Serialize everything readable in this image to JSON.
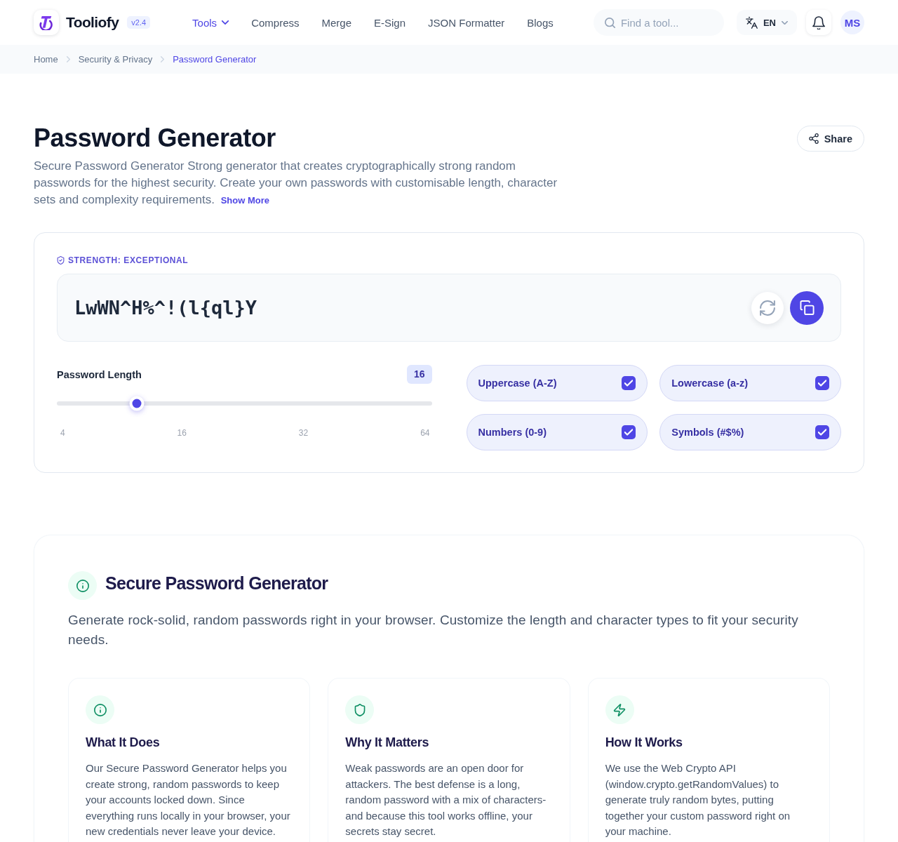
{
  "header": {
    "brand": "Tooliofy",
    "version": "v2.4",
    "nav": [
      {
        "label": "Tools",
        "kind": "menu",
        "selected": true
      },
      {
        "label": "Compress",
        "kind": "link",
        "selected": false
      },
      {
        "label": "Merge",
        "kind": "link",
        "selected": false
      },
      {
        "label": "E-Sign",
        "kind": "link",
        "selected": false
      },
      {
        "label": "JSON Formatter",
        "kind": "link",
        "selected": false
      },
      {
        "label": "Blogs",
        "kind": "link",
        "selected": false
      }
    ],
    "search": {
      "placeholder": "Find a tool..."
    },
    "language": "EN",
    "avatar": "MS"
  },
  "breadcrumb": [
    {
      "label": "Home",
      "current": false
    },
    {
      "label": "Security & Privacy",
      "current": false
    },
    {
      "label": "Password Generator",
      "current": true
    }
  ],
  "intro": {
    "title": "Password Generator",
    "description": "Secure Password Generator Strong generator that creates cryptographically strong random passwords for the highest security. Create your own passwords with customisable length, character sets and complexity requirements.",
    "show_more": "Show More",
    "share": "Share"
  },
  "generator": {
    "strength": "STRENGTH: EXCEPTIONAL",
    "password": "LwWN^H%^!(l{ql}Y",
    "length": {
      "label": "Password Length",
      "value": "16",
      "level": 0.2,
      "ticks": [
        "4",
        "16",
        "32",
        "64"
      ]
    },
    "options": [
      {
        "label": "Uppercase (A-Z)",
        "checked": true
      },
      {
        "label": "Lowercase (a-z)",
        "checked": true
      },
      {
        "label": "Numbers (0-9)",
        "checked": true
      },
      {
        "label": "Symbols (#$%)",
        "checked": true
      }
    ]
  },
  "about": {
    "title": "Secure Password Generator",
    "intro": "Generate rock-solid, random passwords right in your browser. Customize the length and character types to fit your security needs.",
    "cards": [
      {
        "title": "What It Does",
        "text": "Our Secure Password Generator helps you create strong, random passwords to keep your accounts locked down. Since everything runs locally in your browser, your new credentials never leave your device."
      },
      {
        "title": "Why It Matters",
        "text": "Weak passwords are an open door for attackers. The best defense is a long, random password with a mix of characters-and because this tool works offline, your secrets stay secret."
      },
      {
        "title": "How It Works",
        "text": "We use the Web Crypto API (window.crypto.getRandomValues) to generate truly random bytes, putting together your custom password right on your machine."
      }
    ]
  }
}
